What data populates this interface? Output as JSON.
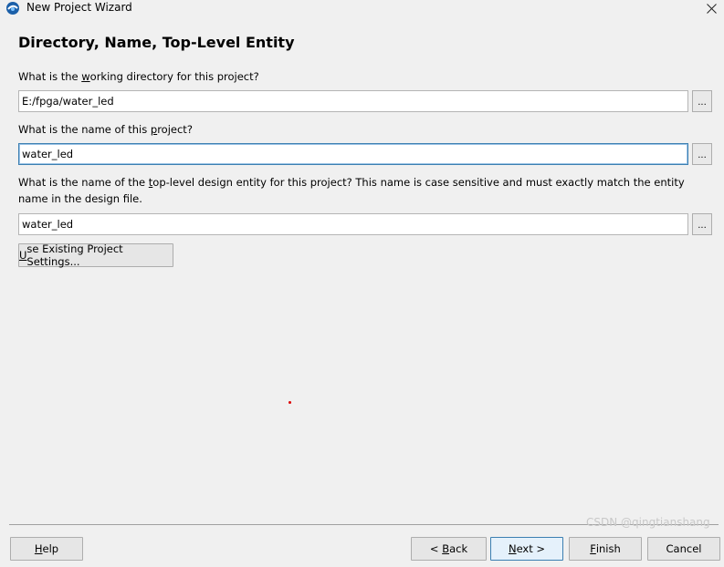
{
  "window": {
    "title": "New Project Wizard"
  },
  "page": {
    "heading": "Directory, Name, Top-Level Entity"
  },
  "working_directory": {
    "question_pre": "What is the ",
    "question_mnemonic": "w",
    "question_post": "orking directory for this project?",
    "value": "E:/fpga/water_led",
    "browse_label": "..."
  },
  "project_name": {
    "question_pre": "What is the name of this ",
    "question_mnemonic": "p",
    "question_post": "roject?",
    "value": "water_led",
    "browse_label": "..."
  },
  "top_level_entity": {
    "question_pre": "What is the name of the ",
    "question_mnemonic": "t",
    "question_post": "op-level design entity for this project? This name is case sensitive and must exactly match the entity name in the design file.",
    "value": "water_led",
    "browse_label": "..."
  },
  "use_existing": {
    "mnemonic": "U",
    "label_rest": "se Existing Project Settings..."
  },
  "buttons": {
    "help": {
      "mnemonic": "H",
      "rest": "elp"
    },
    "back": {
      "prefix": "< ",
      "mnemonic": "B",
      "rest": "ack"
    },
    "next": {
      "mnemonic": "N",
      "rest": "ext >"
    },
    "finish": {
      "mnemonic": "F",
      "rest": "inish"
    },
    "cancel": {
      "label": "Cancel"
    }
  },
  "watermark": "CSDN @qingtianshang"
}
